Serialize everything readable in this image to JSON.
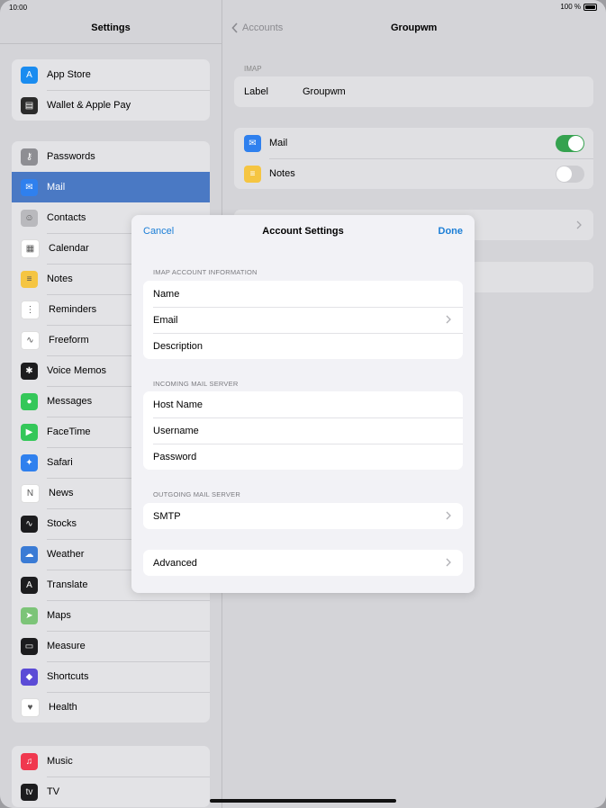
{
  "status": {
    "time": "10:00",
    "battery": "100 %"
  },
  "sidebar": {
    "title": "Settings",
    "group1": [
      {
        "label": "App Store",
        "icon": "app-store-icon",
        "color": "#1a8cf0",
        "glyph": "A"
      },
      {
        "label": "Wallet & Apple Pay",
        "icon": "wallet-icon",
        "color": "#2b2b2b",
        "glyph": "▤"
      }
    ],
    "group2": [
      {
        "label": "Passwords",
        "icon": "key-icon",
        "color": "#8e8e93",
        "glyph": "⚷"
      },
      {
        "label": "Mail",
        "icon": "mail-icon",
        "color": "#2f80ee",
        "glyph": "✉",
        "selected": true
      },
      {
        "label": "Contacts",
        "icon": "contacts-icon",
        "color": "#b9b9bd",
        "glyph": "☺"
      },
      {
        "label": "Calendar",
        "icon": "calendar-icon",
        "color": "#ffffff",
        "glyph": "▦"
      },
      {
        "label": "Notes",
        "icon": "notes-icon",
        "color": "#f5c542",
        "glyph": "≡"
      },
      {
        "label": "Reminders",
        "icon": "reminders-icon",
        "color": "#ffffff",
        "glyph": "⋮"
      },
      {
        "label": "Freeform",
        "icon": "freeform-icon",
        "color": "#ffffff",
        "glyph": "∿"
      },
      {
        "label": "Voice Memos",
        "icon": "voice-memos-icon",
        "color": "#1c1c1e",
        "glyph": "✱"
      },
      {
        "label": "Messages",
        "icon": "messages-icon",
        "color": "#34c759",
        "glyph": "●"
      },
      {
        "label": "FaceTime",
        "icon": "facetime-icon",
        "color": "#34c759",
        "glyph": "▶"
      },
      {
        "label": "Safari",
        "icon": "safari-icon",
        "color": "#2f80ee",
        "glyph": "✦"
      },
      {
        "label": "News",
        "icon": "news-icon",
        "color": "#ffffff",
        "glyph": "N"
      },
      {
        "label": "Stocks",
        "icon": "stocks-icon",
        "color": "#1c1c1e",
        "glyph": "∿"
      },
      {
        "label": "Weather",
        "icon": "weather-icon",
        "color": "#3a7bd5",
        "glyph": "☁"
      },
      {
        "label": "Translate",
        "icon": "translate-icon",
        "color": "#1c1c1e",
        "glyph": "A"
      },
      {
        "label": "Maps",
        "icon": "maps-icon",
        "color": "#7cc478",
        "glyph": "➤"
      },
      {
        "label": "Measure",
        "icon": "measure-icon",
        "color": "#1c1c1e",
        "glyph": "▭"
      },
      {
        "label": "Shortcuts",
        "icon": "shortcuts-icon",
        "color": "#5b4bd6",
        "glyph": "◆"
      },
      {
        "label": "Health",
        "icon": "health-icon",
        "color": "#ffffff",
        "glyph": "♥"
      }
    ],
    "group3": [
      {
        "label": "Music",
        "icon": "music-icon",
        "color": "#f0384f",
        "glyph": "♫"
      },
      {
        "label": "TV",
        "icon": "tv-icon",
        "color": "#1c1c1e",
        "glyph": "tv"
      }
    ]
  },
  "pane": {
    "back_label": "Accounts",
    "title": "Groupwm",
    "imap_section": "IMAP",
    "label_key": "Label",
    "label_value": "Groupwm",
    "mail_label": "Mail",
    "mail_on": true,
    "notes_label": "Notes",
    "notes_on": false
  },
  "modal": {
    "cancel": "Cancel",
    "title": "Account Settings",
    "done": "Done",
    "sections": [
      {
        "header": "IMAP ACCOUNT INFORMATION",
        "rows": [
          {
            "label": "Name",
            "chevron": false
          },
          {
            "label": "Email",
            "chevron": true
          },
          {
            "label": "Description",
            "chevron": false
          }
        ]
      },
      {
        "header": "INCOMING MAIL SERVER",
        "rows": [
          {
            "label": "Host Name",
            "chevron": false
          },
          {
            "label": "Username",
            "chevron": false
          },
          {
            "label": "Password",
            "chevron": false
          }
        ]
      },
      {
        "header": "OUTGOING MAIL SERVER",
        "rows": [
          {
            "label": "SMTP",
            "chevron": true
          }
        ]
      },
      {
        "header": "",
        "rows": [
          {
            "label": "Advanced",
            "chevron": true
          }
        ]
      }
    ]
  }
}
